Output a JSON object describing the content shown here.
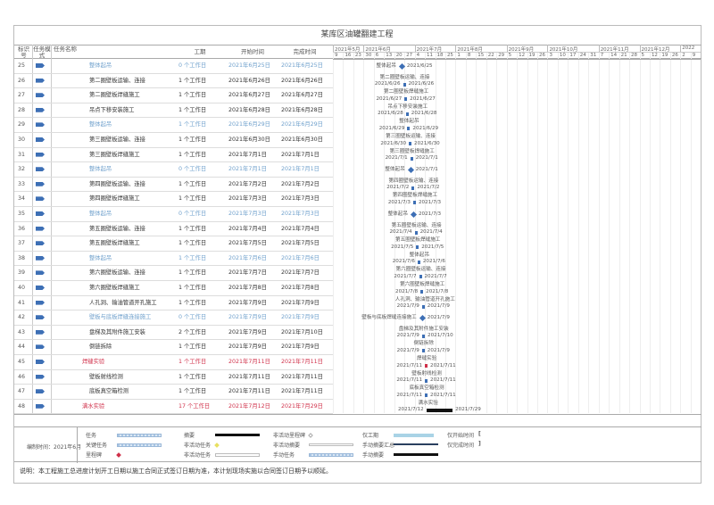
{
  "title": "某库区油罐翻建工程",
  "header": {
    "id": "标识号",
    "mode": "任务模式",
    "name": "任务名称",
    "duration": "工期",
    "start": "开始时间",
    "finish": "完成时间"
  },
  "chart_data": {
    "type": "gantt",
    "timeline_start": "2021/5/9",
    "months": [
      {
        "label": "2021年5月",
        "weeks": [
          "9",
          "16",
          "23"
        ]
      },
      {
        "label": "2021年6月",
        "weeks": [
          "30",
          "6",
          "13",
          "20",
          "27"
        ]
      },
      {
        "label": "2021年7月",
        "weeks": [
          "4",
          "11",
          "18",
          "25"
        ]
      },
      {
        "label": "2021年8月",
        "weeks": [
          "1",
          "8",
          "15",
          "22",
          "29"
        ]
      },
      {
        "label": "2021年9月",
        "weeks": [
          "5",
          "12",
          "19",
          "26"
        ]
      },
      {
        "label": "2021年10月",
        "weeks": [
          "3",
          "10",
          "17",
          "24",
          "31"
        ]
      },
      {
        "label": "2021年11月",
        "weeks": [
          "7",
          "14",
          "21",
          "28"
        ]
      },
      {
        "label": "2021年12月",
        "weeks": [
          "5",
          "12",
          "19",
          "26"
        ]
      },
      {
        "label": "2022",
        "weeks": [
          "2",
          "9"
        ]
      }
    ],
    "tasks": [
      {
        "id": "25",
        "name": "整体起吊",
        "duration": "0 个工作日",
        "start": "2021年6月25日",
        "finish": "2021年6月25日",
        "gs": "2021/6/25",
        "ge": "2021/6/25",
        "style": "inactive"
      },
      {
        "id": "26",
        "name": "第二圈壁板运输、连接",
        "duration": "1 个工作日",
        "start": "2021年6月26日",
        "finish": "2021年6月26日",
        "gs": "2021/6/26",
        "ge": "2021/6/26",
        "style": "normal"
      },
      {
        "id": "27",
        "name": "第二圈壁板焊缝施工",
        "duration": "1 个工作日",
        "start": "2021年6月27日",
        "finish": "2021年6月27日",
        "gs": "2021/6/27",
        "ge": "2021/6/27",
        "style": "normal"
      },
      {
        "id": "28",
        "name": "吊点下移安装施工",
        "duration": "1 个工作日",
        "start": "2021年6月28日",
        "finish": "2021年6月28日",
        "gs": "2021/6/28",
        "ge": "2021/6/28",
        "style": "normal"
      },
      {
        "id": "29",
        "name": "整体起吊",
        "duration": "1 个工作日",
        "start": "2021年6月29日",
        "finish": "2021年6月29日",
        "gs": "2021/6/29",
        "ge": "2021/6/29",
        "style": "inactive"
      },
      {
        "id": "30",
        "name": "第三圈壁板运输、连接",
        "duration": "1 个工作日",
        "start": "2021年6月30日",
        "finish": "2021年6月30日",
        "gs": "2021/6/30",
        "ge": "2021/6/30",
        "style": "normal"
      },
      {
        "id": "31",
        "name": "第三圈壁板焊缝施工",
        "duration": "1 个工作日",
        "start": "2021年7月1日",
        "finish": "2021年7月1日",
        "gs": "2021/7/1",
        "ge": "2021/7/1",
        "style": "normal"
      },
      {
        "id": "32",
        "name": "整体起吊",
        "duration": "0 个工作日",
        "start": "2021年7月1日",
        "finish": "2021年7月1日",
        "gs": "2021/7/1",
        "ge": "2021/7/1",
        "style": "inactive"
      },
      {
        "id": "33",
        "name": "第四圈壁板运输、连接",
        "duration": "1 个工作日",
        "start": "2021年7月2日",
        "finish": "2021年7月2日",
        "gs": "2021/7/2",
        "ge": "2021/7/2",
        "style": "normal"
      },
      {
        "id": "34",
        "name": "第四圈壁板焊缝施工",
        "duration": "1 个工作日",
        "start": "2021年7月3日",
        "finish": "2021年7月3日",
        "gs": "2021/7/3",
        "ge": "2021/7/3",
        "style": "normal"
      },
      {
        "id": "35",
        "name": "整体起吊",
        "duration": "0 个工作日",
        "start": "2021年7月3日",
        "finish": "2021年7月3日",
        "gs": "2021/7/3",
        "ge": "2021/7/3",
        "style": "inactive"
      },
      {
        "id": "36",
        "name": "第五圈壁板运输、连接",
        "duration": "1 个工作日",
        "start": "2021年7月4日",
        "finish": "2021年7月4日",
        "gs": "2021/7/4",
        "ge": "2021/7/4",
        "style": "normal"
      },
      {
        "id": "37",
        "name": "第五圈壁板焊缝施工",
        "duration": "1 个工作日",
        "start": "2021年7月5日",
        "finish": "2021年7月5日",
        "gs": "2021/7/5",
        "ge": "2021/7/5",
        "style": "normal"
      },
      {
        "id": "38",
        "name": "整体起吊",
        "duration": "1 个工作日",
        "start": "2021年7月6日",
        "finish": "2021年7月6日",
        "gs": "2021/7/6",
        "ge": "2021/7/6",
        "style": "inactive"
      },
      {
        "id": "39",
        "name": "第六圈壁板运输、连接",
        "duration": "1 个工作日",
        "start": "2021年7月7日",
        "finish": "2021年7月7日",
        "gs": "2021/7/7",
        "ge": "2021/7/7",
        "style": "normal"
      },
      {
        "id": "40",
        "name": "第六圈壁板焊缝施工",
        "duration": "1 个工作日",
        "start": "2021年7月8日",
        "finish": "2021年7月8日",
        "gs": "2021/7/8",
        "ge": "2021/7/8",
        "style": "normal"
      },
      {
        "id": "41",
        "name": "人孔洞、输油管道开孔施工",
        "duration": "1 个工作日",
        "start": "2021年7月9日",
        "finish": "2021年7月9日",
        "gs": "2021/7/9",
        "ge": "2021/7/9",
        "style": "normal"
      },
      {
        "id": "42",
        "name": "壁板与底板焊缝连接施工",
        "duration": "0 个工作日",
        "start": "2021年7月9日",
        "finish": "2021年7月9日",
        "gs": "2021/7/9",
        "ge": "2021/7/9",
        "style": "inactive"
      },
      {
        "id": "43",
        "name": "盘梯及其附件施工安装",
        "duration": "2 个工作日",
        "start": "2021年7月9日",
        "finish": "2021年7月10日",
        "gs": "2021/7/9",
        "ge": "2021/7/10",
        "style": "normal"
      },
      {
        "id": "44",
        "name": "倒链拆除",
        "duration": "1 个工作日",
        "start": "2021年7月9日",
        "finish": "2021年7月9日",
        "gs": "2021/7/9",
        "ge": "2021/7/9",
        "style": "normal"
      },
      {
        "id": "45",
        "name": "焊缝实验",
        "duration": "1 个工作日",
        "start": "2021年7月11日",
        "finish": "2021年7月11日",
        "gs": "2021/7/11",
        "ge": "2021/7/11",
        "style": "critical"
      },
      {
        "id": "46",
        "name": "壁板射线检测",
        "duration": "1 个工作日",
        "start": "2021年7月11日",
        "finish": "2021年7月11日",
        "gs": "2021/7/11",
        "ge": "2021/7/11",
        "style": "normal"
      },
      {
        "id": "47",
        "name": "底板真空箱检测",
        "duration": "1 个工作日",
        "start": "2021年7月11日",
        "finish": "2021年7月11日",
        "gs": "2021/7/11",
        "ge": "2021/7/11",
        "style": "normal"
      },
      {
        "id": "48",
        "name": "满水实验",
        "duration": "17 个工作日",
        "start": "2021年7月12日",
        "finish": "2021年7月29日",
        "gs": "2021/7/12",
        "ge": "2021/7/29",
        "style": "critical"
      }
    ]
  },
  "colors": {
    "task": "#3d6fb5",
    "inactive": "#6fa0cc",
    "critical": "#d0304a",
    "text": "#333333"
  },
  "legend": {
    "compiled": "编制时间：2021年6月",
    "items": [
      {
        "label": "任务",
        "symbol": "bar-hatched"
      },
      {
        "label": "关键任务",
        "symbol": "bar-hatched"
      },
      {
        "label": "里程碑",
        "symbol": "diamond-red"
      },
      {
        "label": "摘要",
        "symbol": "summary-black"
      },
      {
        "label": "非活动任务",
        "symbol": "diamond-yellow"
      },
      {
        "label": "非活动任务",
        "symbol": "bar-outline"
      },
      {
        "label": "非活动里程碑",
        "symbol": "diamond-outline"
      },
      {
        "label": "非活动摘要",
        "symbol": "summary-outline"
      },
      {
        "label": "手动任务",
        "symbol": "bar-hatched"
      },
      {
        "label": "仅工期",
        "symbol": "bar-lightblue"
      },
      {
        "label": "手动摘要汇总",
        "symbol": "line-dark"
      },
      {
        "label": "手动摘要",
        "symbol": "summary-black"
      },
      {
        "label": "仅开始时间",
        "symbol": "bracket-start"
      },
      {
        "label": "仅完成时间",
        "symbol": "bracket-end"
      }
    ],
    "start_glyph": "[",
    "finish_glyph": "]"
  },
  "note": "说明：本工程施工总进度计划开工日期以施工合同正式签订日期为准，本计划现场实施以合同签订日期予以顺延。"
}
